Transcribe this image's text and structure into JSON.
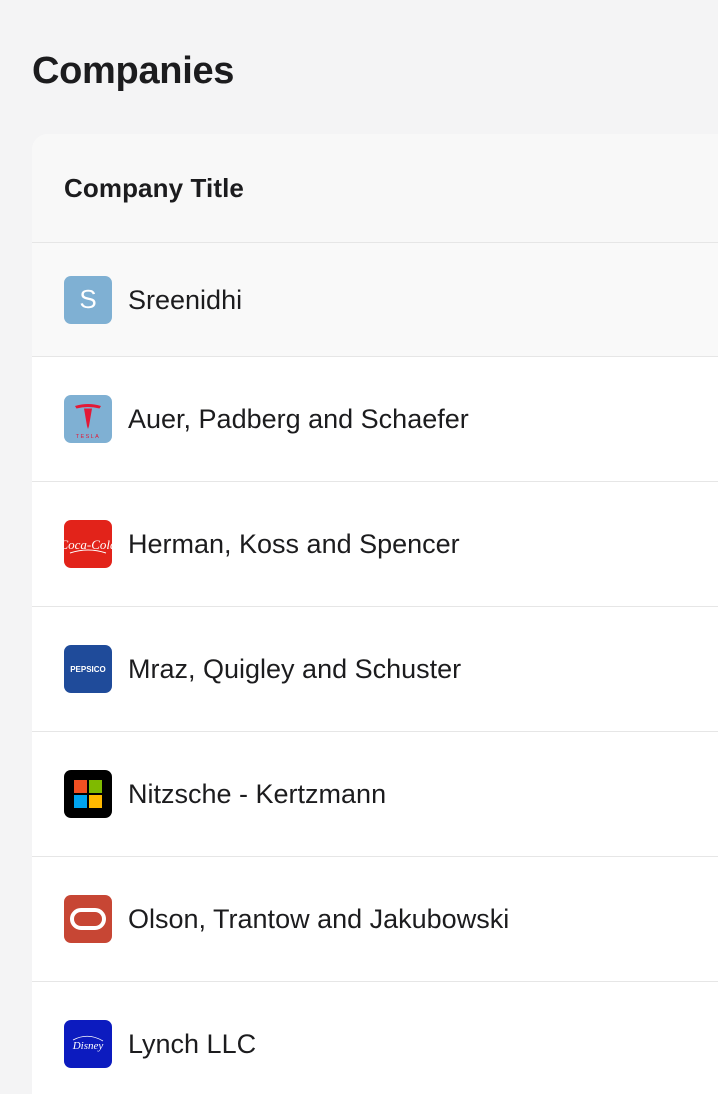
{
  "page": {
    "title": "Companies"
  },
  "table": {
    "column_title": "Company Title",
    "rows": [
      {
        "name": "Sreenidhi",
        "logo": {
          "type": "initial",
          "text": "S",
          "icon": "initial-avatar-icon",
          "bg": "#7fb0d3"
        }
      },
      {
        "name": "Auer, Padberg and Schaefer",
        "logo": {
          "type": "brand",
          "icon": "tesla-logo-icon",
          "bg": "#7fb0d3",
          "wordmark": "TESLA"
        }
      },
      {
        "name": "Herman, Koss and Spencer",
        "logo": {
          "type": "brand",
          "icon": "coca-cola-logo-icon",
          "bg": "#e2231a",
          "wordmark": "Coca-Cola"
        }
      },
      {
        "name": "Mraz, Quigley and Schuster",
        "logo": {
          "type": "brand",
          "icon": "pepsico-logo-icon",
          "bg": "#1f4b9a",
          "wordmark": "PEPSICO"
        }
      },
      {
        "name": "Nitzsche - Kertzmann",
        "logo": {
          "type": "brand",
          "icon": "microsoft-logo-icon",
          "bg": "#000000"
        }
      },
      {
        "name": "Olson, Trantow and Jakubowski",
        "logo": {
          "type": "brand",
          "icon": "oracle-logo-icon",
          "bg": "#c74634"
        }
      },
      {
        "name": "Lynch LLC",
        "logo": {
          "type": "brand",
          "icon": "disney-logo-icon",
          "bg": "#0c1bbf",
          "wordmark": "Disney"
        }
      }
    ]
  }
}
